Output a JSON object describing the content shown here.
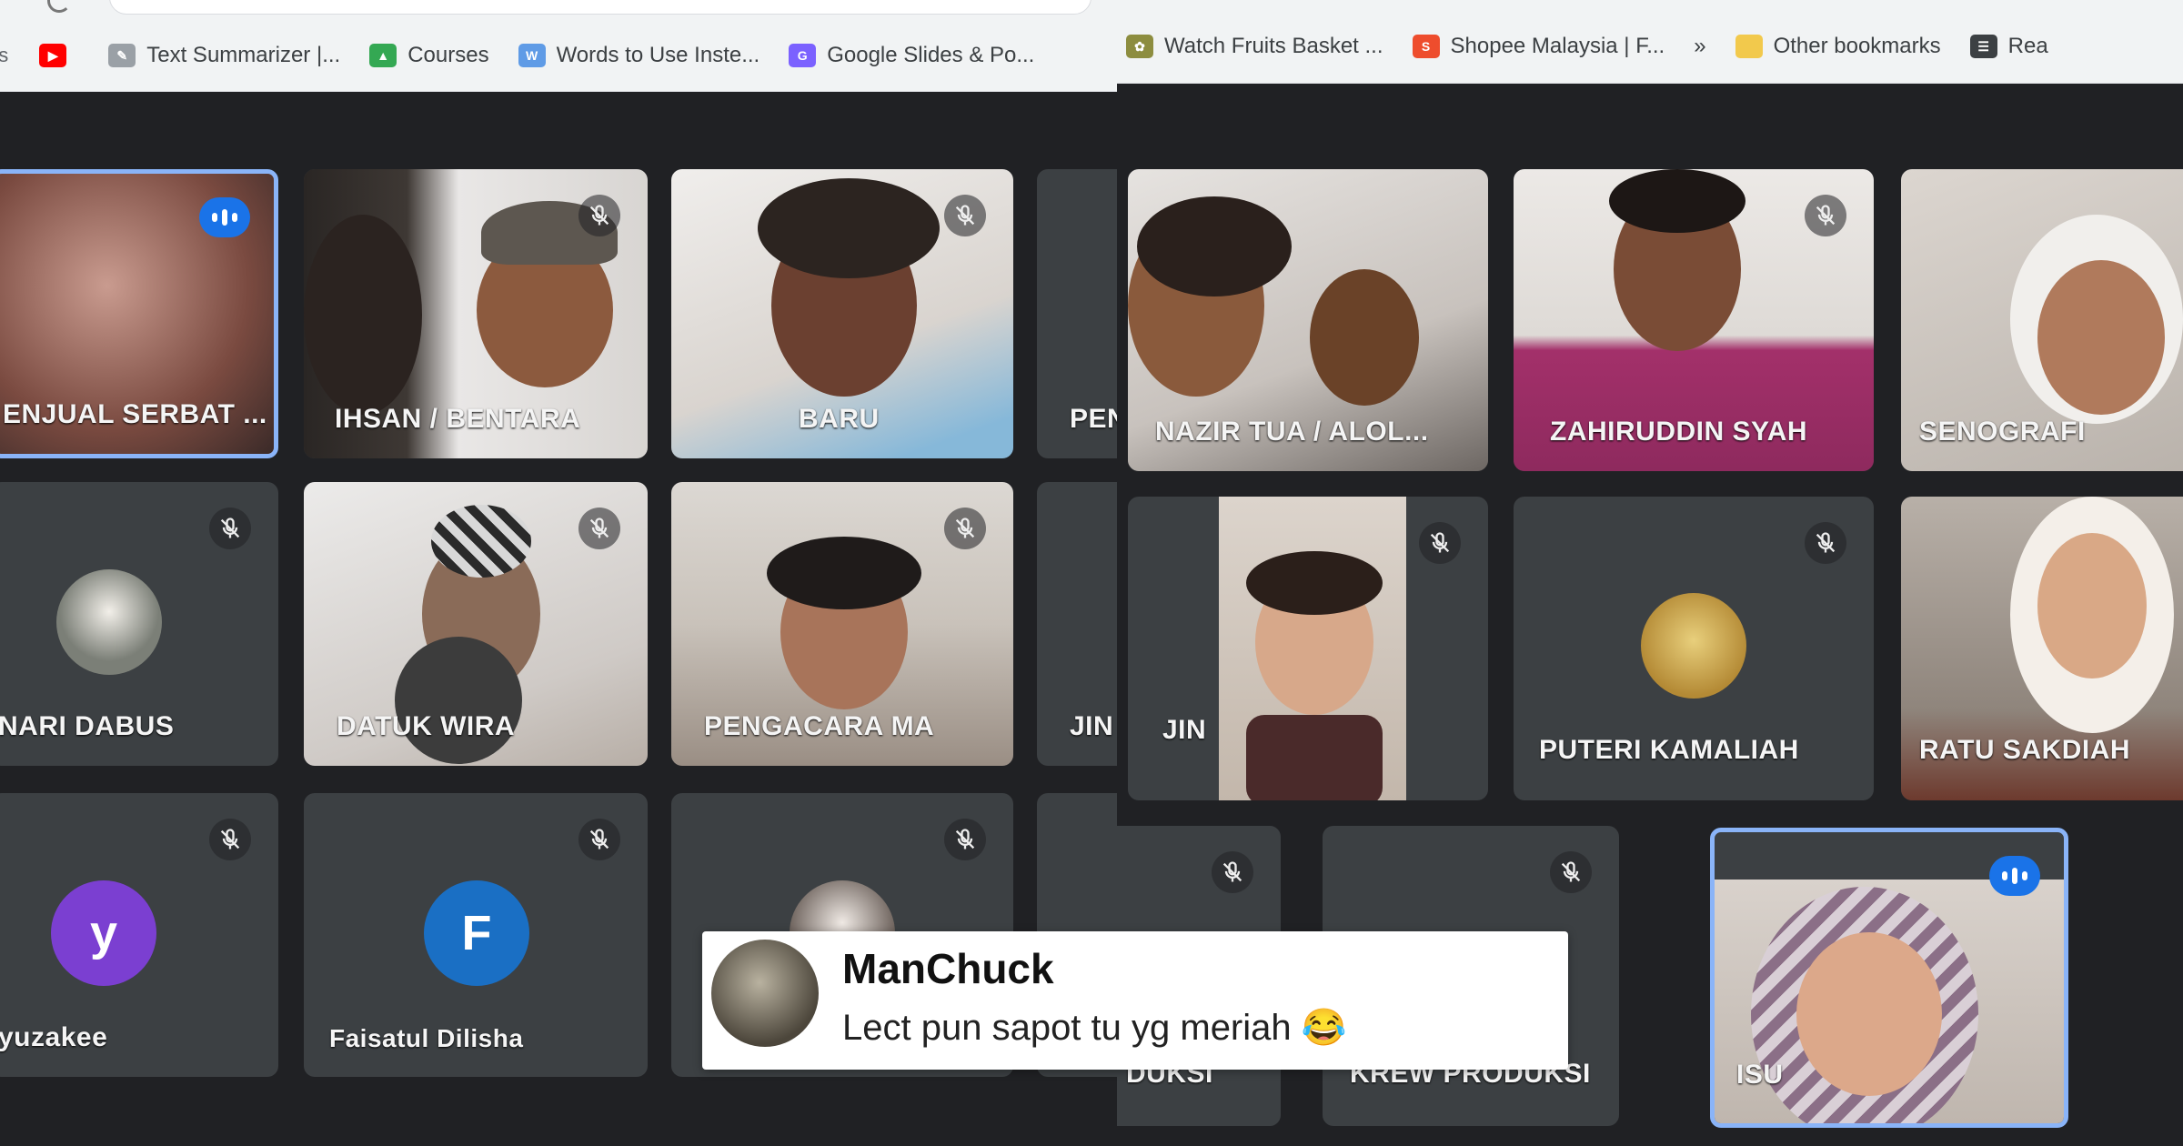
{
  "left_window": {
    "bookmarks": [
      {
        "label": "Text Summarizer |...",
        "icon": "text-summarizer-icon",
        "color": "#9aa0a6"
      },
      {
        "label": "Courses",
        "icon": "courses-icon",
        "color": "#34a853"
      },
      {
        "label": "Words to Use Inste...",
        "icon": "words-icon",
        "color": "#5f9be6"
      },
      {
        "label": "Google Slides & Po...",
        "icon": "slides-icon",
        "color": "#7b61ff"
      }
    ],
    "tiles": [
      {
        "name": "ENJUAL SERBAT ...",
        "speaking": true
      },
      {
        "name": "IHSAN / BENTARA",
        "muted": true
      },
      {
        "name": "BARU",
        "muted": true
      },
      {
        "name": "PEN"
      },
      {
        "name": "NARI DABUS",
        "muted": true
      },
      {
        "name": "DATUK WIRA",
        "muted": true
      },
      {
        "name": "PENGACARA MA",
        "muted": true
      },
      {
        "name": "JIN"
      },
      {
        "name": "yuzakee",
        "avatar_letter": "y",
        "avatar_color": "#7b3fd1",
        "muted": true
      },
      {
        "name": "Faisatul Dilisha",
        "avatar_letter": "F",
        "avatar_color": "#1a6fc4",
        "muted": true
      },
      {
        "name": "",
        "muted": true
      }
    ]
  },
  "right_window": {
    "bookmarks": [
      {
        "label": "Watch Fruits Basket ...",
        "icon": "fruits-basket-icon",
        "color": "#8d8d3f"
      },
      {
        "label": "Shopee Malaysia | F...",
        "icon": "shopee-icon",
        "color": "#ee4d2d"
      },
      {
        "label": "»",
        "icon": "more-bookmarks-icon",
        "color": "#777777"
      },
      {
        "label": "Other bookmarks",
        "icon": "folder-icon",
        "color": "#f2c94c"
      },
      {
        "label": "Rea",
        "icon": "reading-list-icon",
        "color": "#3c4043"
      }
    ],
    "tiles": [
      {
        "name": "NAZIR TUA / ALOL..."
      },
      {
        "name": "ZAHIRUDDIN SYAH",
        "muted": true
      },
      {
        "name": "SENOGRAFI"
      },
      {
        "name": "JIN",
        "muted": true
      },
      {
        "name": "PUTERI KAMALIAH",
        "muted": true
      },
      {
        "name": "RATU SAKDIAH"
      },
      {
        "name": "DUKSI",
        "muted": true
      },
      {
        "name": "KREW PRODUKSI",
        "muted": true
      },
      {
        "name": "ISU",
        "speaking": true
      }
    ]
  },
  "comment": {
    "author": "ManChuck",
    "text": "Lect pun sapot tu yg meriah 😂"
  }
}
